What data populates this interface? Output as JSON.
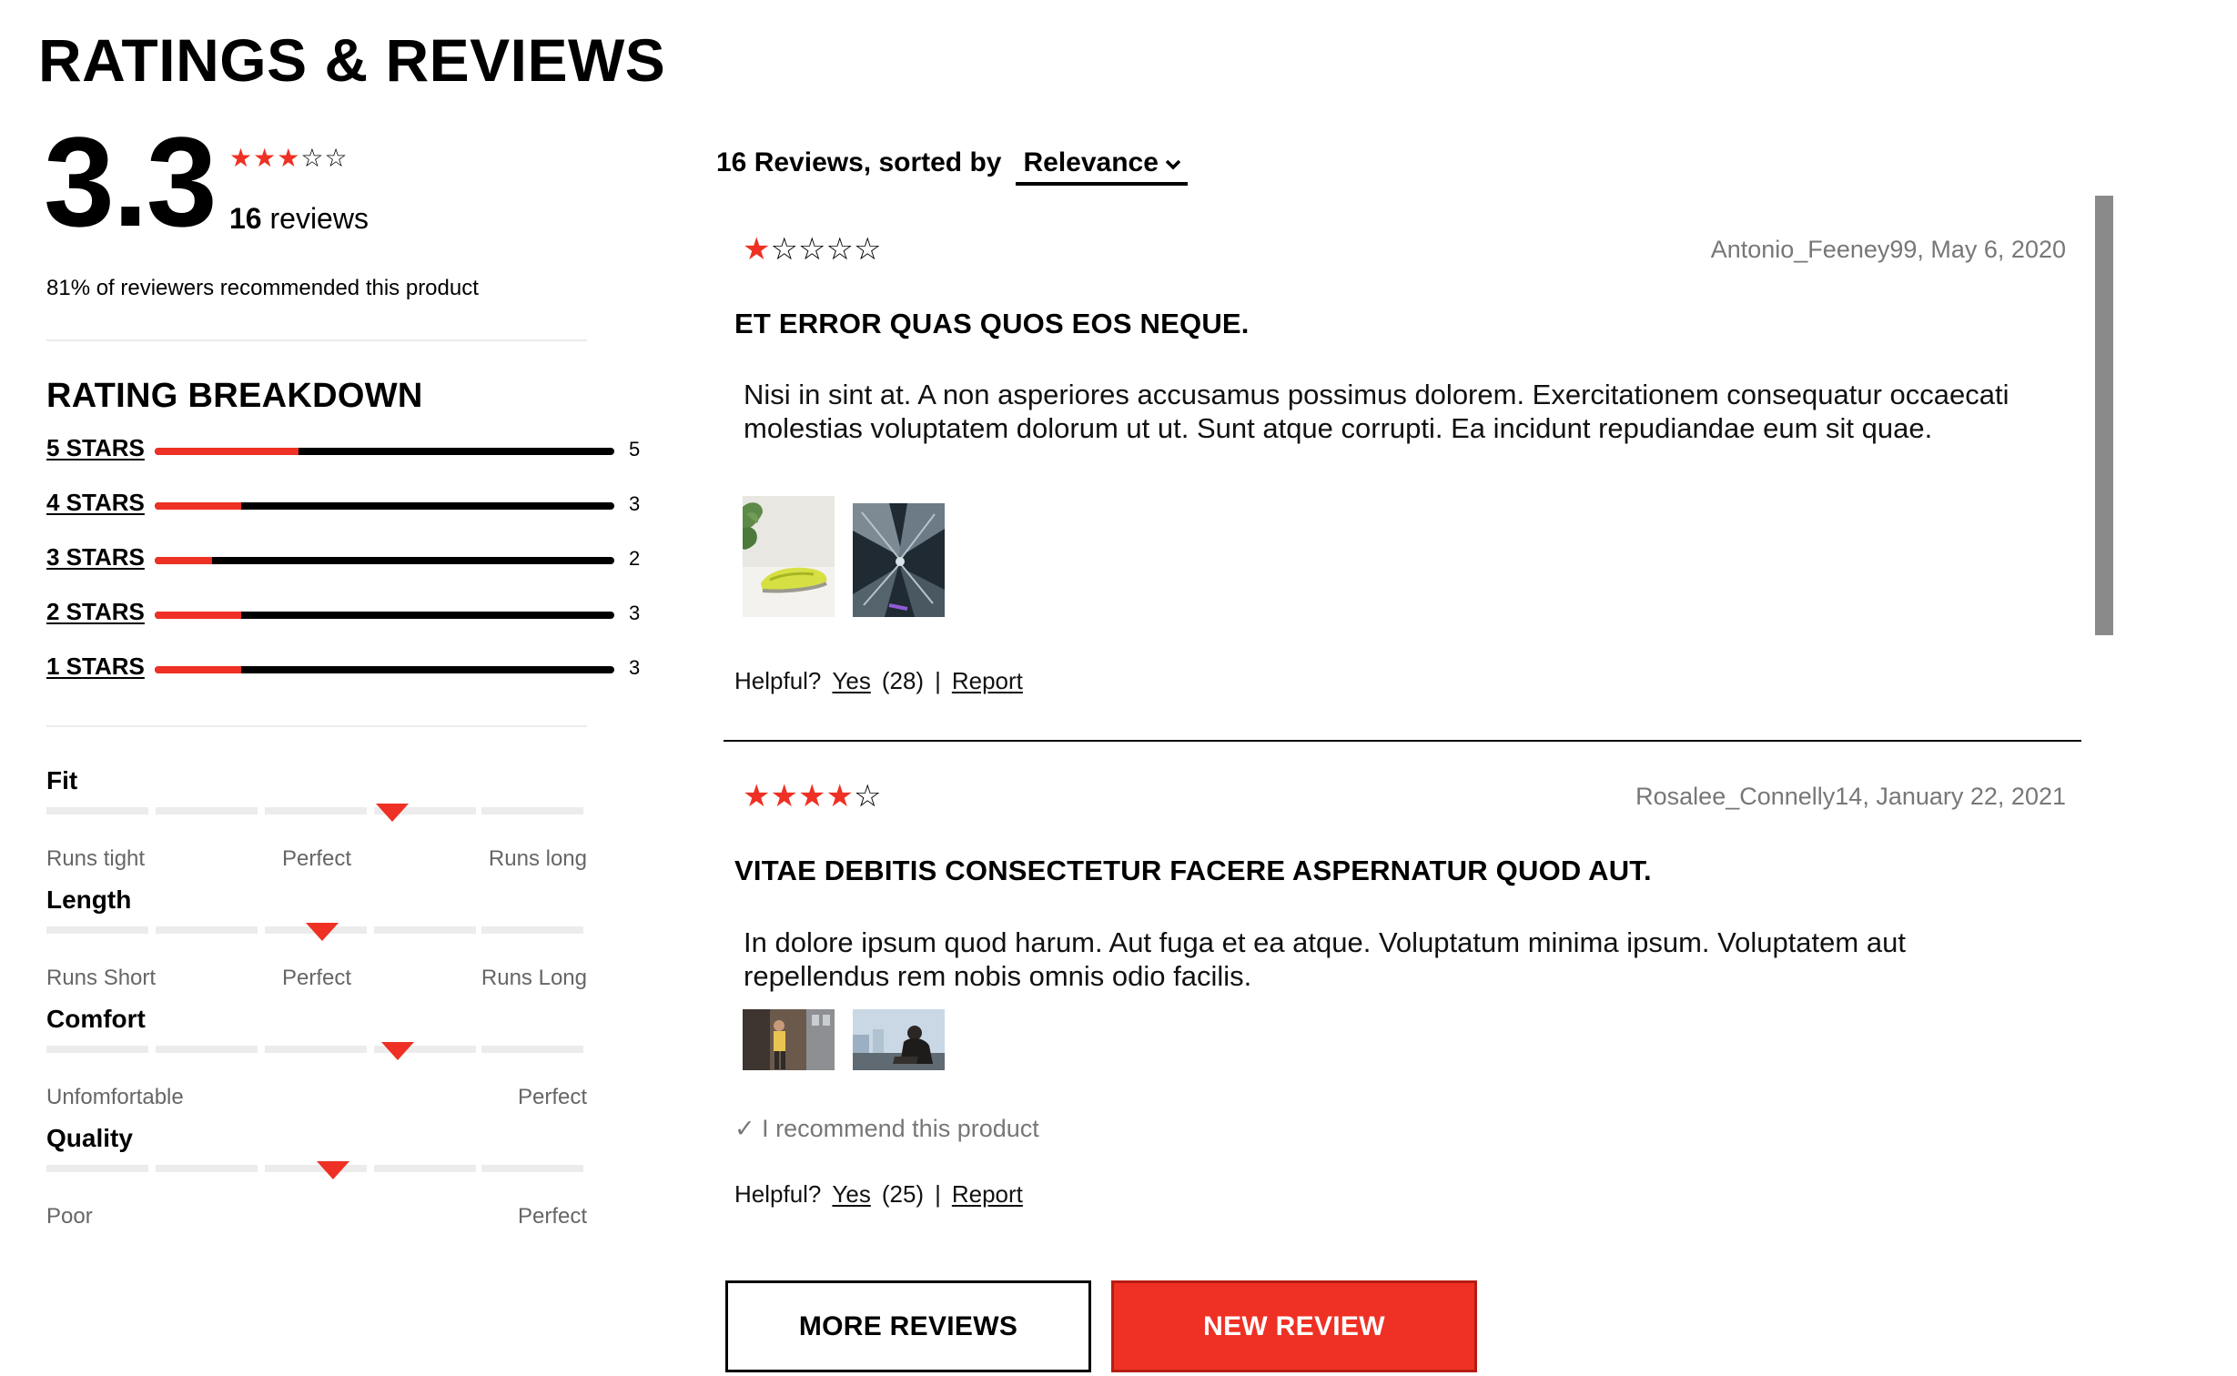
{
  "page": {
    "title": "RATINGS & REVIEWS"
  },
  "summary": {
    "average": "3.3",
    "average_value": 3.3,
    "stars_filled": 3,
    "stars_total": 5,
    "review_count_num": "16",
    "review_count_word": "reviews",
    "recommend_text": "81% of reviewers recommended this product"
  },
  "breakdown": {
    "heading": "RATING BREAKDOWN",
    "rows": [
      {
        "label": "5 STARS",
        "count": "5",
        "fraction": 0.3125
      },
      {
        "label": "4 STARS",
        "count": "3",
        "fraction": 0.1875
      },
      {
        "label": "3 STARS",
        "count": "2",
        "fraction": 0.125
      },
      {
        "label": "2 STARS",
        "count": "3",
        "fraction": 0.1875
      },
      {
        "label": "1 STARS",
        "count": "3",
        "fraction": 0.1875
      }
    ]
  },
  "characteristics": [
    {
      "name": "Fit",
      "left": "Runs tight",
      "middle": "Perfect",
      "right": "Runs long",
      "value": 0.64
    },
    {
      "name": "Length",
      "left": "Runs Short",
      "middle": "Perfect",
      "right": "Runs Long",
      "value": 0.51
    },
    {
      "name": "Comfort",
      "left": "Unfomfortable",
      "middle": "",
      "right": "Perfect",
      "value": 0.65
    },
    {
      "name": "Quality",
      "left": "Poor",
      "middle": "",
      "right": "Perfect",
      "value": 0.53
    }
  ],
  "sort": {
    "prefix": "16 Reviews, sorted by",
    "selected": "Relevance"
  },
  "reviews": [
    {
      "rating": 1,
      "meta": "Antonio_Feeney99, May 6, 2020",
      "title": "ET ERROR QUAS QUOS EOS NEQUE.",
      "body": "Nisi in sint at. A non asperiores accusamus possimus dolorem. Exercitationem consequatur occaecati molestias voluptatem dolorum ut ut. Sunt atque corrupti. Ea incidunt repudiandae eum sit quae.",
      "photos": [
        "sneaker-photo",
        "city-aerial-photo"
      ],
      "recommend": "",
      "helpful_label": "Helpful?",
      "yes_label": "Yes",
      "yes_count": "(28)",
      "separator": "|",
      "report_label": "Report"
    },
    {
      "rating": 4,
      "meta": "Rosalee_Connelly14, January 22, 2021",
      "title": "VITAE DEBITIS CONSECTETUR FACERE ASPERNATUR QUOD AUT.",
      "body": "In dolore ipsum quod harum. Aut fuga et ea atque. Voluptatum minima ipsum. Voluptatem aut repellendus rem nobis omnis odio facilis.",
      "photos": [
        "street-person-photo",
        "city-sitting-photo"
      ],
      "recommend": "✓ I recommend this product",
      "helpful_label": "Helpful?",
      "yes_label": "Yes",
      "yes_count": "(25)",
      "separator": "|",
      "report_label": "Report"
    }
  ],
  "buttons": {
    "more_reviews": "MORE REVIEWS",
    "new_review": "NEW REVIEW"
  },
  "colors": {
    "accent": "#ee3124",
    "text": "#111111",
    "muted": "#777777",
    "track": "#ececec"
  },
  "icons": {
    "star_filled": "star-filled-icon",
    "star_empty": "star-empty-icon",
    "sort_chevron": "chevron-down-icon",
    "check": "check-icon"
  }
}
